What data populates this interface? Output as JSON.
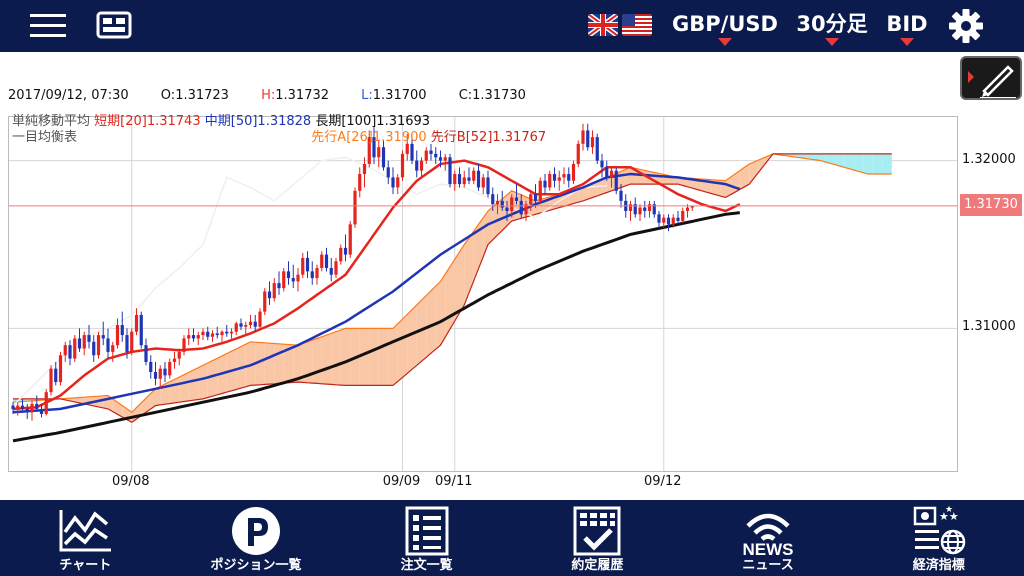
{
  "header": {
    "pair": "GBP/USD",
    "timeframe": "30分足",
    "price_type": "BID"
  },
  "ohlc": {
    "datetime": "2017/09/12, 07:30",
    "open_label": "O:",
    "open": "1.31723",
    "high_label": "H:",
    "high": "1.31732",
    "low_label": "L:",
    "low": "1.31700",
    "close_label": "C:",
    "close": "1.31730"
  },
  "legend": {
    "sma_title": "単純移動平均",
    "sma_short": "短期[20]1.31743",
    "sma_mid": "中期[50]1.31828",
    "sma_long": "長期[100]1.31693",
    "ichimoku_title": "一目均衡表",
    "span_a": "先行A[26]1.31900",
    "span_b": "先行B[52]1.31767"
  },
  "colors": {
    "header_bg": "#0b1b4d",
    "accent_red": "#e53b3b",
    "sma_short": "#e5241e",
    "sma_mid": "#2035b5",
    "sma_long": "#111111",
    "candle_up": "#e5241e",
    "candle_down": "#2035b5",
    "cloud_bull": "#f9c6a6",
    "cloud_bear": "#a6eef2",
    "span_a": "#ff7a1a",
    "span_b": "#c0261a"
  },
  "icons": {
    "menu": "hamburger-icon",
    "grid": "layout-grid-icon",
    "settings": "gear-icon",
    "draw": "pencil-icon"
  },
  "nav": [
    {
      "label": "チャート",
      "icon": "chart-icon"
    },
    {
      "label": "ポジション一覧",
      "icon": "position-p-icon"
    },
    {
      "label": "注文一覧",
      "icon": "order-list-icon"
    },
    {
      "label": "約定履歴",
      "icon": "execution-history-icon"
    },
    {
      "label": "ニュース",
      "icon": "news-icon",
      "icon_text": "NEWS"
    },
    {
      "label": "経済指標",
      "icon": "economic-indicator-icon"
    }
  ],
  "chart_data": {
    "type": "candlestick",
    "symbol": "GBP/USD",
    "timeframe": "30分足",
    "y_ticks": [
      1.31,
      1.32
    ],
    "y_tick_labels": [
      "1.31000",
      "1.32000"
    ],
    "ylim": [
      1.3015,
      1.3226
    ],
    "current_price": "1.31730",
    "current_price_value": 1.3173,
    "x_ticks": [
      {
        "label": "09/08",
        "index": 25
      },
      {
        "label": "09/09",
        "index": 82
      },
      {
        "label": "09/11",
        "index": 93
      },
      {
        "label": "09/12",
        "index": 137
      }
    ],
    "candles": [
      [
        1.3054,
        1.3056,
        1.3049,
        1.3052
      ],
      [
        1.3052,
        1.3056,
        1.3048,
        1.3054
      ],
      [
        1.3054,
        1.3058,
        1.305,
        1.3052
      ],
      [
        1.3052,
        1.3055,
        1.3046,
        1.305
      ],
      [
        1.305,
        1.3057,
        1.3045,
        1.3055
      ],
      [
        1.3055,
        1.306,
        1.3051,
        1.3052
      ],
      [
        1.3052,
        1.3055,
        1.3047,
        1.3049
      ],
      [
        1.3049,
        1.3064,
        1.3048,
        1.3062
      ],
      [
        1.3062,
        1.3078,
        1.306,
        1.3076
      ],
      [
        1.3076,
        1.308,
        1.3066,
        1.3068
      ],
      [
        1.3068,
        1.3086,
        1.3066,
        1.3084
      ],
      [
        1.3084,
        1.3092,
        1.308,
        1.309
      ],
      [
        1.309,
        1.3093,
        1.3078,
        1.3082
      ],
      [
        1.3082,
        1.3096,
        1.308,
        1.3094
      ],
      [
        1.3094,
        1.31,
        1.3086,
        1.3088
      ],
      [
        1.3088,
        1.3098,
        1.3084,
        1.3096
      ],
      [
        1.3096,
        1.3102,
        1.3088,
        1.3092
      ],
      [
        1.3092,
        1.3096,
        1.308,
        1.3084
      ],
      [
        1.3084,
        1.3098,
        1.3082,
        1.3096
      ],
      [
        1.3096,
        1.3104,
        1.309,
        1.3094
      ],
      [
        1.3094,
        1.31,
        1.3082,
        1.3086
      ],
      [
        1.3086,
        1.3092,
        1.308,
        1.309
      ],
      [
        1.309,
        1.3106,
        1.3088,
        1.3102
      ],
      [
        1.3102,
        1.311,
        1.3092,
        1.3096
      ],
      [
        1.3096,
        1.31,
        1.3082,
        1.3086
      ],
      [
        1.3086,
        1.31,
        1.3084,
        1.3098
      ],
      [
        1.3098,
        1.3112,
        1.3096,
        1.3108
      ],
      [
        1.3108,
        1.311,
        1.3088,
        1.309
      ],
      [
        1.309,
        1.3094,
        1.3078,
        1.308
      ],
      [
        1.308,
        1.3084,
        1.307,
        1.3074
      ],
      [
        1.3074,
        1.308,
        1.3066,
        1.307
      ],
      [
        1.307,
        1.3078,
        1.3064,
        1.3076
      ],
      [
        1.3076,
        1.308,
        1.3068,
        1.3072
      ],
      [
        1.3072,
        1.3082,
        1.307,
        1.308
      ],
      [
        1.308,
        1.3086,
        1.3076,
        1.3082
      ],
      [
        1.3082,
        1.3088,
        1.3078,
        1.3086
      ],
      [
        1.3086,
        1.3096,
        1.3084,
        1.3094
      ],
      [
        1.3094,
        1.31,
        1.309,
        1.3096
      ],
      [
        1.3096,
        1.31,
        1.3092,
        1.3094
      ],
      [
        1.3094,
        1.3098,
        1.309,
        1.3096
      ],
      [
        1.3096,
        1.31,
        1.3093,
        1.3098
      ],
      [
        1.3098,
        1.3101,
        1.3093,
        1.3095
      ],
      [
        1.3095,
        1.3099,
        1.3092,
        1.3097
      ],
      [
        1.3097,
        1.3101,
        1.3094,
        1.3096
      ],
      [
        1.3096,
        1.3099,
        1.3092,
        1.3098
      ],
      [
        1.3098,
        1.3102,
        1.3095,
        1.3097
      ],
      [
        1.3097,
        1.31,
        1.3094,
        1.3098
      ],
      [
        1.3098,
        1.3104,
        1.3096,
        1.3103
      ],
      [
        1.3103,
        1.3106,
        1.3099,
        1.3101
      ],
      [
        1.3101,
        1.3104,
        1.3096,
        1.3102
      ],
      [
        1.3102,
        1.3108,
        1.31,
        1.3104
      ],
      [
        1.3104,
        1.3108,
        1.3098,
        1.3101
      ],
      [
        1.3101,
        1.3112,
        1.31,
        1.311
      ],
      [
        1.311,
        1.3124,
        1.3108,
        1.3122
      ],
      [
        1.3122,
        1.3128,
        1.3114,
        1.3118
      ],
      [
        1.3118,
        1.313,
        1.3116,
        1.3127
      ],
      [
        1.3127,
        1.3134,
        1.312,
        1.3124
      ],
      [
        1.3124,
        1.3136,
        1.3122,
        1.3134
      ],
      [
        1.3134,
        1.314,
        1.3126,
        1.313
      ],
      [
        1.313,
        1.3138,
        1.3124,
        1.3128
      ],
      [
        1.3128,
        1.3136,
        1.3122,
        1.3132
      ],
      [
        1.3132,
        1.3145,
        1.313,
        1.3142
      ],
      [
        1.3142,
        1.3146,
        1.313,
        1.3134
      ],
      [
        1.3134,
        1.314,
        1.3126,
        1.313
      ],
      [
        1.313,
        1.3138,
        1.3126,
        1.3136
      ],
      [
        1.3136,
        1.3146,
        1.3134,
        1.3144
      ],
      [
        1.3144,
        1.3148,
        1.3134,
        1.3136
      ],
      [
        1.3136,
        1.3142,
        1.3128,
        1.3132
      ],
      [
        1.3132,
        1.3142,
        1.313,
        1.314
      ],
      [
        1.314,
        1.315,
        1.3138,
        1.3148
      ],
      [
        1.3148,
        1.3156,
        1.314,
        1.3144
      ],
      [
        1.3144,
        1.3164,
        1.3142,
        1.3162
      ],
      [
        1.3162,
        1.3184,
        1.316,
        1.3182
      ],
      [
        1.3182,
        1.3196,
        1.3178,
        1.3192
      ],
      [
        1.3192,
        1.3202,
        1.3184,
        1.3198
      ],
      [
        1.3198,
        1.3218,
        1.3196,
        1.3214
      ],
      [
        1.3214,
        1.322,
        1.3198,
        1.3202
      ],
      [
        1.3202,
        1.3212,
        1.3196,
        1.3208
      ],
      [
        1.3208,
        1.3212,
        1.3194,
        1.3196
      ],
      [
        1.3196,
        1.32,
        1.3186,
        1.319
      ],
      [
        1.319,
        1.3196,
        1.318,
        1.3184
      ],
      [
        1.3184,
        1.3192,
        1.318,
        1.319
      ],
      [
        1.319,
        1.3206,
        1.3188,
        1.3204
      ],
      [
        1.3204,
        1.3216,
        1.32,
        1.321
      ],
      [
        1.321,
        1.3214,
        1.3198,
        1.32
      ],
      [
        1.32,
        1.3206,
        1.319,
        1.3194
      ],
      [
        1.3194,
        1.3202,
        1.319,
        1.32
      ],
      [
        1.32,
        1.3208,
        1.3198,
        1.3206
      ],
      [
        1.3206,
        1.321,
        1.32,
        1.3204
      ],
      [
        1.3204,
        1.3208,
        1.3198,
        1.3202
      ],
      [
        1.3202,
        1.3206,
        1.3196,
        1.32
      ],
      [
        1.32,
        1.3204,
        1.3194,
        1.3202
      ],
      [
        1.3202,
        1.3204,
        1.3184,
        1.3186
      ],
      [
        1.3186,
        1.3194,
        1.3182,
        1.3192
      ],
      [
        1.3192,
        1.3196,
        1.3184,
        1.3186
      ],
      [
        1.3186,
        1.3194,
        1.3184,
        1.319
      ],
      [
        1.319,
        1.3196,
        1.3186,
        1.3188
      ],
      [
        1.3188,
        1.3196,
        1.3186,
        1.3194
      ],
      [
        1.3194,
        1.3198,
        1.3182,
        1.3184
      ],
      [
        1.3184,
        1.3192,
        1.318,
        1.319
      ],
      [
        1.319,
        1.3194,
        1.3178,
        1.318
      ],
      [
        1.318,
        1.3184,
        1.317,
        1.3174
      ],
      [
        1.3174,
        1.318,
        1.3168,
        1.3176
      ],
      [
        1.3176,
        1.3182,
        1.317,
        1.3172
      ],
      [
        1.3172,
        1.3176,
        1.3164,
        1.317
      ],
      [
        1.317,
        1.318,
        1.3166,
        1.3178
      ],
      [
        1.3178,
        1.3186,
        1.3174,
        1.3176
      ],
      [
        1.3176,
        1.318,
        1.3166,
        1.3168
      ],
      [
        1.3168,
        1.3176,
        1.3164,
        1.3174
      ],
      [
        1.3174,
        1.3182,
        1.317,
        1.318
      ],
      [
        1.318,
        1.3186,
        1.3172,
        1.3176
      ],
      [
        1.3176,
        1.319,
        1.3174,
        1.3188
      ],
      [
        1.3188,
        1.3192,
        1.318,
        1.3184
      ],
      [
        1.3184,
        1.3194,
        1.3182,
        1.3192
      ],
      [
        1.3192,
        1.3196,
        1.3184,
        1.3188
      ],
      [
        1.3188,
        1.3194,
        1.3182,
        1.319
      ],
      [
        1.319,
        1.3196,
        1.3186,
        1.3192
      ],
      [
        1.3192,
        1.3196,
        1.3184,
        1.3188
      ],
      [
        1.3188,
        1.32,
        1.3186,
        1.3198
      ],
      [
        1.3198,
        1.3212,
        1.3196,
        1.321
      ],
      [
        1.321,
        1.3222,
        1.3206,
        1.3218
      ],
      [
        1.3218,
        1.3222,
        1.3206,
        1.3208
      ],
      [
        1.3208,
        1.3218,
        1.3204,
        1.3214
      ],
      [
        1.3214,
        1.3216,
        1.3198,
        1.32
      ],
      [
        1.32,
        1.3204,
        1.319,
        1.3196
      ],
      [
        1.3196,
        1.32,
        1.3188,
        1.319
      ],
      [
        1.319,
        1.3196,
        1.3184,
        1.3194
      ],
      [
        1.3194,
        1.3196,
        1.318,
        1.3182
      ],
      [
        1.3182,
        1.3186,
        1.3172,
        1.3176
      ],
      [
        1.3176,
        1.318,
        1.3166,
        1.317
      ],
      [
        1.317,
        1.3176,
        1.3164,
        1.3174
      ],
      [
        1.3174,
        1.3178,
        1.3166,
        1.3168
      ],
      [
        1.3168,
        1.3174,
        1.3164,
        1.3172
      ],
      [
        1.3172,
        1.3176,
        1.3166,
        1.317
      ],
      [
        1.317,
        1.3176,
        1.3166,
        1.3174
      ],
      [
        1.3174,
        1.3176,
        1.3166,
        1.3168
      ],
      [
        1.3168,
        1.317,
        1.316,
        1.3163
      ],
      [
        1.3163,
        1.3168,
        1.316,
        1.3166
      ],
      [
        1.3166,
        1.3168,
        1.3158,
        1.3162
      ],
      [
        1.3162,
        1.3168,
        1.316,
        1.3166
      ],
      [
        1.3166,
        1.317,
        1.3162,
        1.3164
      ],
      [
        1.3164,
        1.3172,
        1.3163,
        1.317
      ],
      [
        1.317,
        1.3174,
        1.3166,
        1.3172
      ],
      [
        1.3172,
        1.3173,
        1.317,
        1.3173
      ]
    ],
    "sma_short": [
      [
        0,
        1.3052
      ],
      [
        5,
        1.3053
      ],
      [
        10,
        1.306
      ],
      [
        15,
        1.3072
      ],
      [
        20,
        1.3082
      ],
      [
        25,
        1.3086
      ],
      [
        30,
        1.3088
      ],
      [
        35,
        1.3087
      ],
      [
        40,
        1.3088
      ],
      [
        45,
        1.3092
      ],
      [
        50,
        1.3097
      ],
      [
        55,
        1.3103
      ],
      [
        60,
        1.3112
      ],
      [
        65,
        1.3122
      ],
      [
        70,
        1.3132
      ],
      [
        75,
        1.3152
      ],
      [
        80,
        1.3172
      ],
      [
        85,
        1.3188
      ],
      [
        90,
        1.3198
      ],
      [
        95,
        1.32
      ],
      [
        100,
        1.3196
      ],
      [
        105,
        1.3188
      ],
      [
        110,
        1.318
      ],
      [
        115,
        1.318
      ],
      [
        120,
        1.3186
      ],
      [
        125,
        1.3196
      ],
      [
        130,
        1.3196
      ],
      [
        135,
        1.3188
      ],
      [
        140,
        1.318
      ],
      [
        145,
        1.3174
      ],
      [
        150,
        1.317
      ],
      [
        153,
        1.3174
      ]
    ],
    "sma_mid": [
      [
        0,
        1.305
      ],
      [
        10,
        1.3052
      ],
      [
        20,
        1.3058
      ],
      [
        30,
        1.3064
      ],
      [
        40,
        1.307
      ],
      [
        50,
        1.3078
      ],
      [
        60,
        1.309
      ],
      [
        70,
        1.3104
      ],
      [
        80,
        1.3122
      ],
      [
        90,
        1.3144
      ],
      [
        100,
        1.3162
      ],
      [
        110,
        1.3174
      ],
      [
        120,
        1.3184
      ],
      [
        125,
        1.319
      ],
      [
        130,
        1.3192
      ],
      [
        140,
        1.319
      ],
      [
        150,
        1.3186
      ],
      [
        153,
        1.3183
      ]
    ],
    "sma_long": [
      [
        0,
        1.3033
      ],
      [
        10,
        1.3038
      ],
      [
        20,
        1.3044
      ],
      [
        30,
        1.305
      ],
      [
        40,
        1.3056
      ],
      [
        50,
        1.3062
      ],
      [
        60,
        1.307
      ],
      [
        70,
        1.308
      ],
      [
        80,
        1.3092
      ],
      [
        90,
        1.3104
      ],
      [
        100,
        1.312
      ],
      [
        110,
        1.3134
      ],
      [
        120,
        1.3146
      ],
      [
        130,
        1.3156
      ],
      [
        140,
        1.3162
      ],
      [
        150,
        1.3168
      ],
      [
        153,
        1.3169
      ]
    ],
    "span_a": [
      [
        0,
        1.3056
      ],
      [
        10,
        1.3058
      ],
      [
        20,
        1.306
      ],
      [
        25,
        1.305
      ],
      [
        30,
        1.3064
      ],
      [
        40,
        1.3078
      ],
      [
        50,
        1.3092
      ],
      [
        60,
        1.309
      ],
      [
        70,
        1.31
      ],
      [
        80,
        1.31
      ],
      [
        90,
        1.3128
      ],
      [
        95,
        1.315
      ],
      [
        100,
        1.317
      ],
      [
        105,
        1.3182
      ],
      [
        110,
        1.3176
      ],
      [
        120,
        1.3184
      ],
      [
        130,
        1.3196
      ],
      [
        140,
        1.319
      ],
      [
        150,
        1.3188
      ],
      [
        155,
        1.3198
      ],
      [
        160,
        1.3204
      ],
      [
        170,
        1.32
      ],
      [
        180,
        1.3192
      ],
      [
        185,
        1.3192
      ]
    ],
    "span_b": [
      [
        0,
        1.3058
      ],
      [
        10,
        1.3058
      ],
      [
        20,
        1.3052
      ],
      [
        25,
        1.3044
      ],
      [
        30,
        1.3054
      ],
      [
        40,
        1.3058
      ],
      [
        50,
        1.3066
      ],
      [
        60,
        1.3068
      ],
      [
        70,
        1.3066
      ],
      [
        80,
        1.3066
      ],
      [
        90,
        1.309
      ],
      [
        95,
        1.3114
      ],
      [
        100,
        1.315
      ],
      [
        105,
        1.3164
      ],
      [
        110,
        1.3168
      ],
      [
        120,
        1.3176
      ],
      [
        130,
        1.3186
      ],
      [
        140,
        1.3186
      ],
      [
        150,
        1.3178
      ],
      [
        155,
        1.3186
      ],
      [
        160,
        1.3204
      ],
      [
        170,
        1.3204
      ],
      [
        180,
        1.3204
      ],
      [
        185,
        1.3204
      ]
    ],
    "lagging_span": [
      [
        0,
        1.3054
      ],
      [
        5,
        1.3068
      ],
      [
        10,
        1.3082
      ],
      [
        15,
        1.3095
      ],
      [
        20,
        1.31
      ],
      [
        25,
        1.3108
      ],
      [
        30,
        1.3124
      ],
      [
        35,
        1.3136
      ],
      [
        40,
        1.315
      ],
      [
        45,
        1.319
      ],
      [
        50,
        1.3184
      ],
      [
        55,
        1.3176
      ],
      [
        60,
        1.3188
      ],
      [
        65,
        1.32
      ],
      [
        70,
        1.3202
      ],
      [
        75,
        1.3196
      ],
      [
        80,
        1.3188
      ],
      [
        85,
        1.318
      ],
      [
        90,
        1.3186
      ],
      [
        95,
        1.3184
      ],
      [
        100,
        1.3178
      ],
      [
        105,
        1.3172
      ],
      [
        110,
        1.3166
      ],
      [
        115,
        1.3176
      ],
      [
        120,
        1.3184
      ],
      [
        125,
        1.3185
      ]
    ]
  }
}
